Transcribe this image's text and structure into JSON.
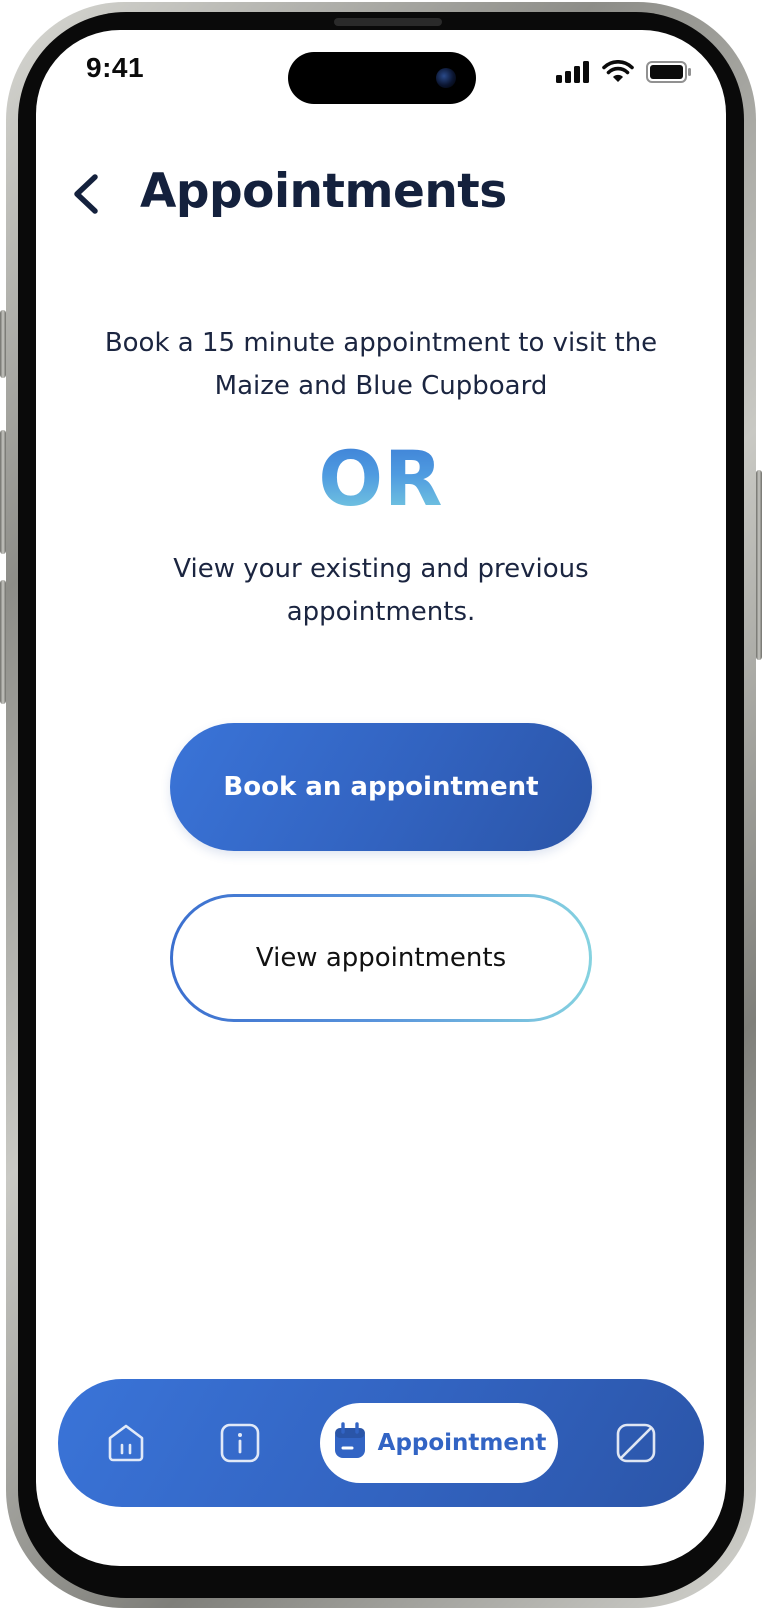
{
  "status_bar": {
    "time": "9:41"
  },
  "header": {
    "title": "Appointments",
    "back_icon": "chevron-left-icon"
  },
  "content": {
    "intro_text": "Book a 15 minute appointment to visit the Maize and Blue Cupboard",
    "or_text": "OR",
    "secondary_text": "View your existing and previous appointments."
  },
  "actions": {
    "book_label": "Book an appointment",
    "view_label": "View appointments"
  },
  "bottom_nav": {
    "items": [
      {
        "icon": "home-icon",
        "active": false
      },
      {
        "icon": "info-icon",
        "active": false
      },
      {
        "icon": "calendar-icon",
        "label": "Appointment",
        "active": true
      },
      {
        "icon": "slash-square-icon",
        "active": false
      }
    ]
  },
  "colors": {
    "title": "#14213d",
    "body_text": "#1b2540",
    "primary_blue": "#3264c4",
    "accent_light": "#86d3e0",
    "background": "#ffffff"
  }
}
